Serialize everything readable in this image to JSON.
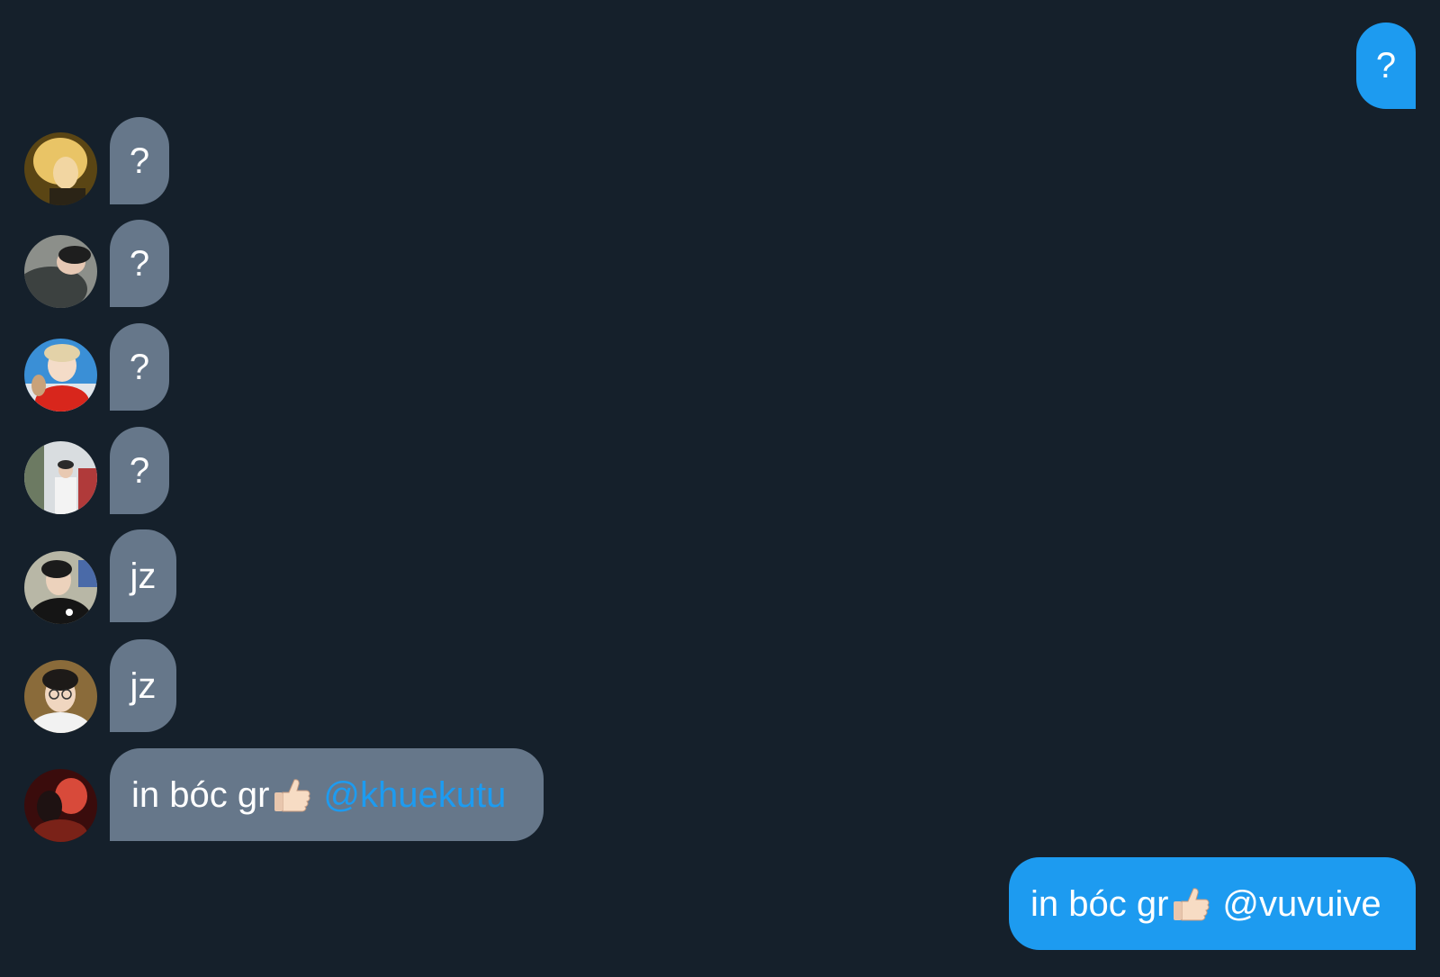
{
  "conversation": {
    "messages": [
      {
        "direction": "out",
        "text": "?"
      },
      {
        "direction": "in",
        "avatar": "avatar-blonde-hair",
        "text": "?"
      },
      {
        "direction": "in",
        "avatar": "avatar-lying-down",
        "text": "?"
      },
      {
        "direction": "in",
        "avatar": "avatar-red-sweater-rabbit",
        "text": "?"
      },
      {
        "direction": "in",
        "avatar": "avatar-standing-outdoors",
        "text": "?"
      },
      {
        "direction": "in",
        "avatar": "avatar-black-shirt",
        "text": "jz"
      },
      {
        "direction": "in",
        "avatar": "avatar-glasses-smiling",
        "text": "jz"
      },
      {
        "direction": "in",
        "avatar": "avatar-red-lit-duo",
        "text": "in bóc gr",
        "emoji": "thumbs-up-icon",
        "mention": "@khuekutu"
      },
      {
        "direction": "out",
        "text": "in bóc gr",
        "emoji": "thumbs-up-icon",
        "mention": "@vuvuive"
      }
    ]
  },
  "colors": {
    "background": "#15202b",
    "incoming_bubble": "#66778a",
    "outgoing_bubble": "#1d9bf0",
    "mention": "#1d9bf0",
    "text": "#ffffff"
  }
}
